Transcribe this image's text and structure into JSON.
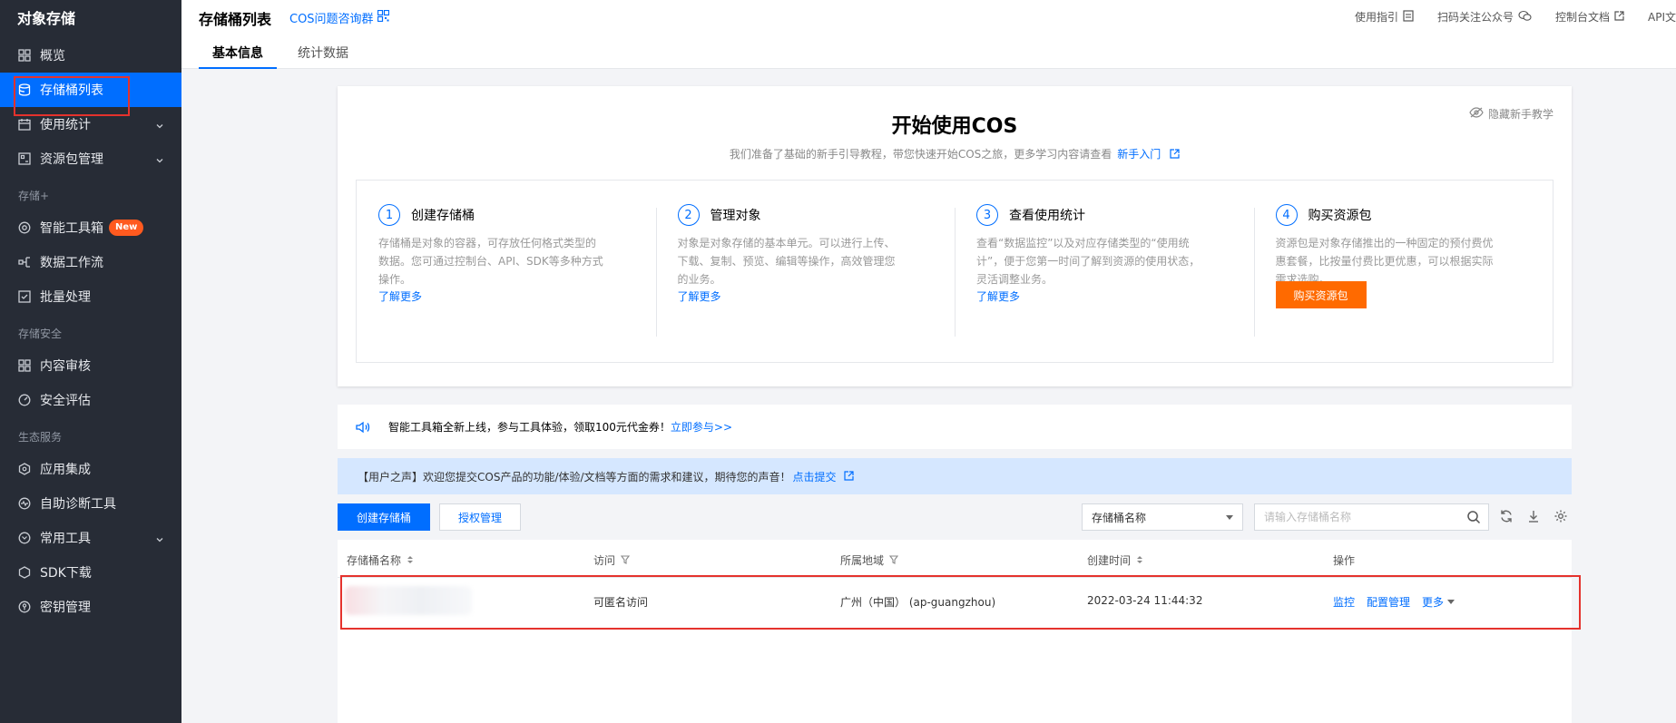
{
  "sidebar": {
    "title": "对象存储",
    "items": [
      {
        "label": "概览",
        "icon": "grid-icon"
      },
      {
        "label": "存储桶列表",
        "icon": "bucket-icon"
      },
      {
        "label": "使用统计",
        "icon": "calendar-icon"
      },
      {
        "label": "资源包管理",
        "icon": "package-icon"
      }
    ],
    "sections": [
      {
        "label": "存储+",
        "items": [
          {
            "label": "智能工具箱",
            "icon": "toolbox-icon",
            "badge": "New"
          },
          {
            "label": "数据工作流",
            "icon": "workflow-icon"
          },
          {
            "label": "批量处理",
            "icon": "batch-icon"
          }
        ]
      },
      {
        "label": "存储安全",
        "items": [
          {
            "label": "内容审核",
            "icon": "grid-icon"
          },
          {
            "label": "安全评估",
            "icon": "gauge-icon"
          }
        ]
      },
      {
        "label": "生态服务",
        "items": [
          {
            "label": "应用集成",
            "icon": "integration-icon"
          },
          {
            "label": "自助诊断工具",
            "icon": "diagnosis-icon"
          },
          {
            "label": "常用工具",
            "icon": "tools-icon"
          },
          {
            "label": "SDK下载",
            "icon": "sdk-icon"
          },
          {
            "label": "密钥管理",
            "icon": "key-icon"
          }
        ]
      }
    ]
  },
  "header": {
    "title": "存储桶列表",
    "group_link": "COS问题咨询群",
    "links": [
      "使用指引",
      "扫码关注公众号",
      "控制台文档",
      "API文"
    ],
    "tabs": [
      "基本信息",
      "统计数据"
    ]
  },
  "guide": {
    "title": "开始使用COS",
    "subtitle": "我们准备了基础的新手引导教程，带您快速开始COS之旅，更多学习内容请查看",
    "subtitle_link": "新手入门",
    "hide_label": "隐藏新手教学",
    "steps": [
      {
        "num": "1",
        "title": "创建存储桶",
        "desc": "存储桶是对象的容器，可存放任何格式类型的数据。您可通过控制台、API、SDK等多种方式操作。",
        "link": "了解更多"
      },
      {
        "num": "2",
        "title": "管理对象",
        "desc": "对象是对象存储的基本单元。可以进行上传、下载、复制、预览、编辑等操作，高效管理您的业务。",
        "link": "了解更多"
      },
      {
        "num": "3",
        "title": "查看使用统计",
        "desc": "查看“数据监控”以及对应存储类型的“使用统计”，便于您第一时间了解到资源的使用状态，灵活调整业务。",
        "link": "了解更多"
      },
      {
        "num": "4",
        "title": "购买资源包",
        "desc": "资源包是对象存储推出的一种固定的预付费优惠套餐，比按量付费比更优惠，可以根据实际需求选购。",
        "button": "购买资源包"
      }
    ]
  },
  "notice": {
    "text": "智能工具箱全新上线，参与工具体验，领取100元代金券！",
    "link": "立即参与>>"
  },
  "infobar": {
    "text": "【用户之声】欢迎您提交COS产品的功能/体验/文档等方面的需求和建议，期待您的声音！",
    "link": "点击提交"
  },
  "toolbar": {
    "create": "创建存储桶",
    "auth": "授权管理",
    "select_value": "存储桶名称",
    "search_placeholder": "请输入存储桶名称"
  },
  "table": {
    "columns": [
      "存储桶名称",
      "访问",
      "所属地域",
      "创建时间",
      "操作"
    ],
    "rows": [
      {
        "name": "",
        "access": "可匿名访问",
        "region": "广州（中国） (ap-guangzhou)",
        "created": "2022-03-24 11:44:32",
        "ops": [
          "监控",
          "配置管理",
          "更多"
        ]
      }
    ]
  },
  "colors": {
    "accent": "#006eff",
    "sidebar_bg": "#272c36",
    "orange": "#ff6a00",
    "highlight": "#e5322d"
  }
}
